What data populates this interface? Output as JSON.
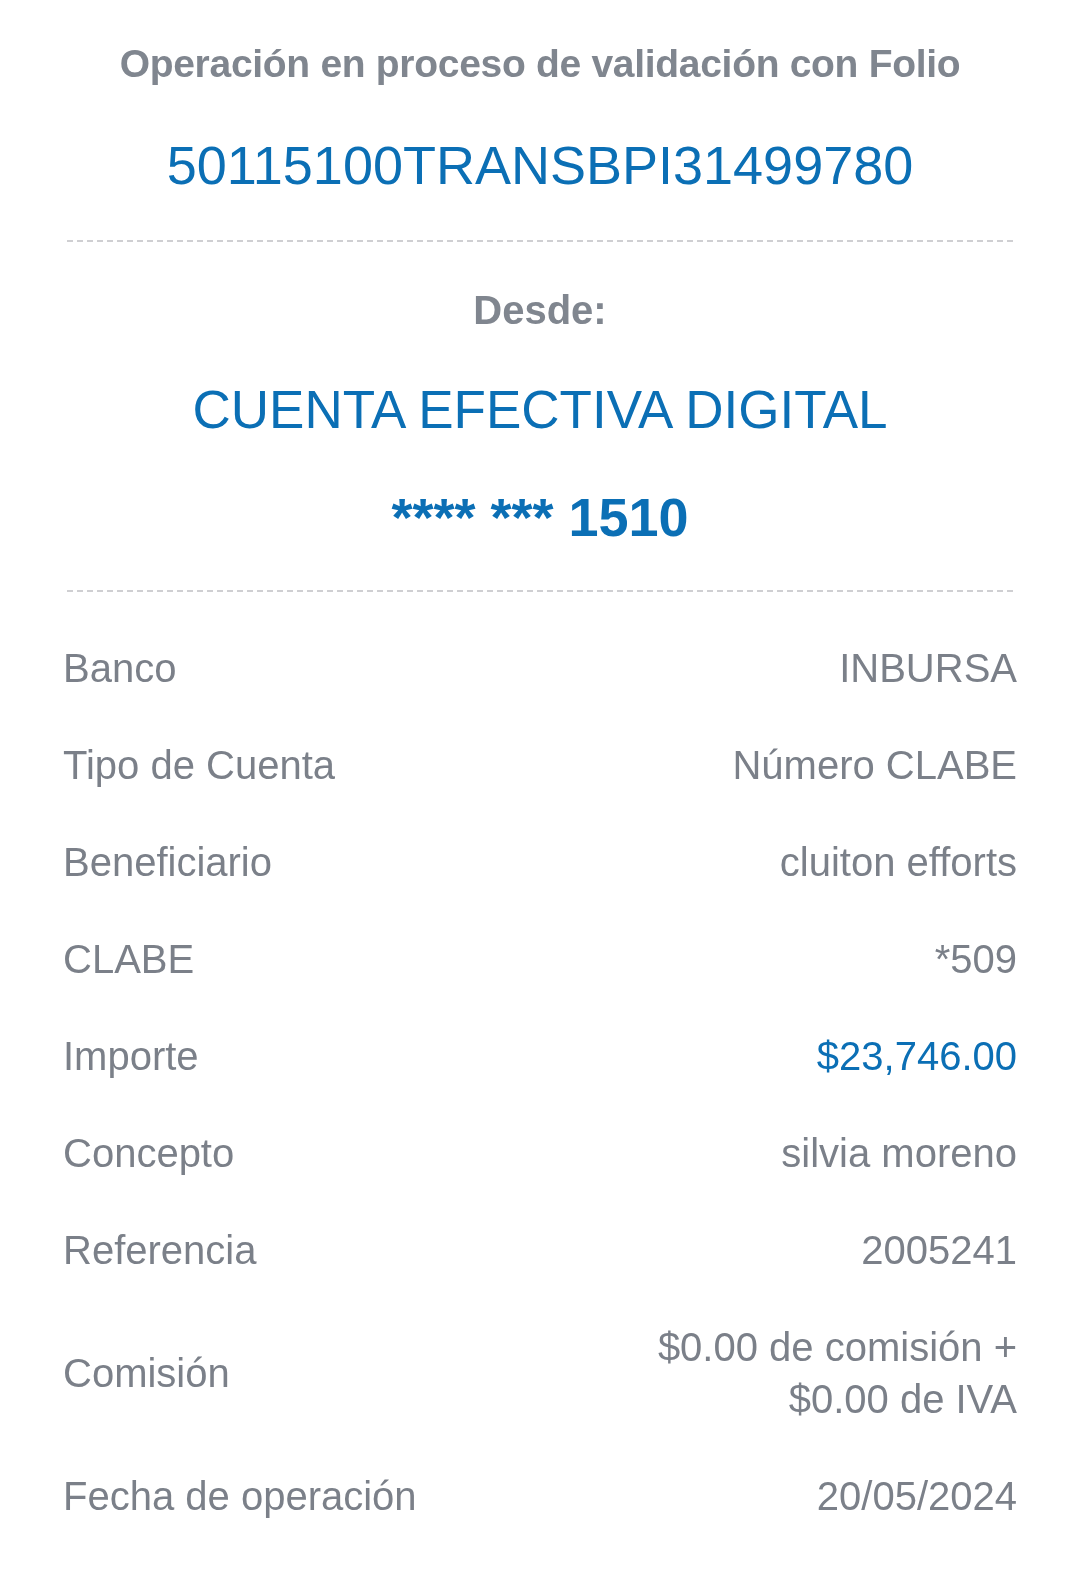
{
  "header": {
    "message": "Operación en proceso de validación con Folio",
    "folio": "50115100TRANSBPI31499780"
  },
  "source": {
    "label": "Desde:",
    "account_name": "CUENTA EFECTIVA DIGITAL",
    "account_number": "**** *** 1510"
  },
  "details": [
    {
      "label": "Banco",
      "value": "INBURSA",
      "highlighted": false
    },
    {
      "label": "Tipo de Cuenta",
      "value": "Número CLABE",
      "highlighted": false
    },
    {
      "label": "Beneficiario",
      "value": "cluiton efforts",
      "highlighted": false
    },
    {
      "label": "CLABE",
      "value": "*509",
      "highlighted": false
    },
    {
      "label": "Importe",
      "value": "$23,746.00",
      "highlighted": true
    },
    {
      "label": "Concepto",
      "value": "silvia moreno",
      "highlighted": false
    },
    {
      "label": "Referencia",
      "value": "2005241",
      "highlighted": false
    },
    {
      "label": "Comisión",
      "value": "$0.00 de comisión + $0.00 de IVA",
      "highlighted": false
    },
    {
      "label": "Fecha de operación",
      "value": "20/05/2024",
      "highlighted": false
    }
  ]
}
